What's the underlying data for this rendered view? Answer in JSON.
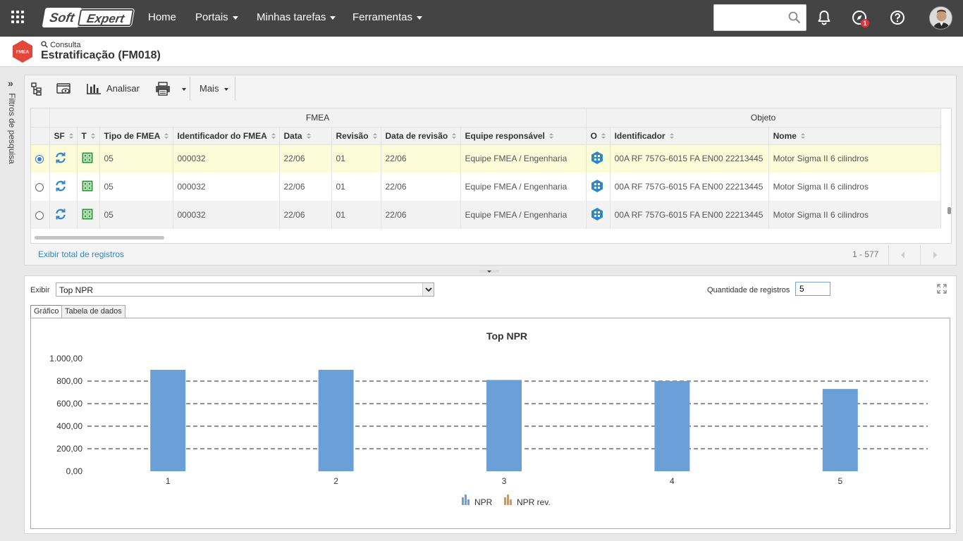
{
  "nav": {
    "home": "Home",
    "portais": "Portais",
    "tarefas": "Minhas tarefas",
    "ferramentas": "Ferramentas",
    "logo_left": "Soft",
    "logo_right": "Expert",
    "search_value": "",
    "notification_count": "1"
  },
  "header": {
    "crumb": "Consulta",
    "title": "Estratificação (FM018)",
    "logo_text": "FMEA"
  },
  "sidebar": {
    "label": "Filtros de pesquisa"
  },
  "toolbar": {
    "analisar": "Analisar",
    "mais": "Mais"
  },
  "grid": {
    "group_fmea": "FMEA",
    "group_objeto": "Objeto",
    "columns": [
      "SF",
      "T",
      "Tipo de FMEA",
      "Identificador do FMEA",
      "Data",
      "Revisão",
      "Data de revisão",
      "Equipe responsável",
      "O",
      "Identificador",
      "Nome"
    ],
    "rows": [
      {
        "tipo": "05",
        "id": "000032",
        "data": "22/06",
        "revisao": "01",
        "data_rev": "22/06",
        "equipe": "Equipe FMEA / Engenharia",
        "obj_id": "00A RF 757G-6015 FA EN00 22213445",
        "nome": "Motor Sigma II 6 cilindros",
        "selected": true
      },
      {
        "tipo": "05",
        "id": "000032",
        "data": "22/06",
        "revisao": "01",
        "data_rev": "22/06",
        "equipe": "Equipe FMEA / Engenharia",
        "obj_id": "00A RF 757G-6015 FA EN00 22213445",
        "nome": "Motor Sigma II 6 cilindros",
        "selected": false
      },
      {
        "tipo": "05",
        "id": "000032",
        "data": "22/06",
        "revisao": "01",
        "data_rev": "22/06",
        "equipe": "Equipe FMEA / Engenharia",
        "obj_id": "00A RF 757G-6015 FA EN00 22213445",
        "nome": "Motor Sigma II 6 cilindros",
        "selected": false
      }
    ],
    "total_link": "Exibir total de registros",
    "range": "1 - 577"
  },
  "panel": {
    "exibir_label": "Exibir",
    "exibir_value": "Top NPR",
    "qtd_label": "Quantidade de registros",
    "qtd_value": "5",
    "tab_grafico": "Gráfico",
    "tab_tabela": "Tabela de dados"
  },
  "colors": {
    "bar": "#6a9fd8",
    "npr_rev": "#e8914a",
    "accent": "#2f86c9"
  },
  "chart_data": {
    "type": "bar",
    "title": "Top NPR",
    "categories": [
      "1",
      "2",
      "3",
      "4",
      "5"
    ],
    "series": [
      {
        "name": "NPR",
        "values": [
          900,
          900,
          810,
          800,
          730
        ]
      },
      {
        "name": "NPR rev.",
        "values": []
      }
    ],
    "yticks": [
      "1.000,00",
      "800,00",
      "600,00",
      "400,00",
      "200,00",
      "0,00"
    ],
    "ylim": [
      0,
      1000
    ],
    "grid": "dashed",
    "legend": "bottom-center"
  }
}
